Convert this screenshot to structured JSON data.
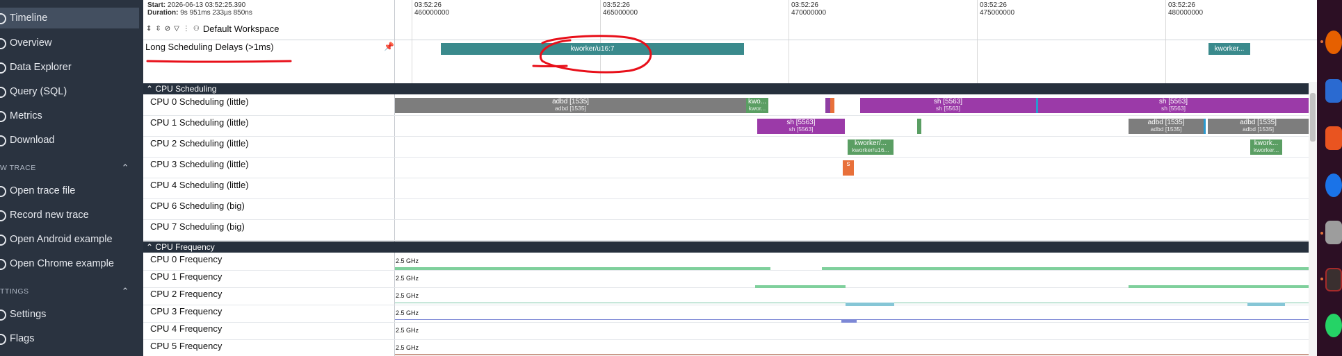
{
  "sidebar": {
    "items_top": [
      {
        "label": "Timeline",
        "icon": "timeline-icon"
      },
      {
        "label": "Overview",
        "icon": "overview-icon"
      },
      {
        "label": "Data Explorer",
        "icon": "data-explorer-icon"
      },
      {
        "label": "Query (SQL)",
        "icon": "query-icon"
      },
      {
        "label": "Metrics",
        "icon": "metrics-icon"
      },
      {
        "label": "Download",
        "icon": "download-icon"
      }
    ],
    "section_trace": "W TRACE",
    "items_trace": [
      {
        "label": "Open trace file",
        "icon": "open-file-icon"
      },
      {
        "label": "Record new trace",
        "icon": "record-icon"
      },
      {
        "label": "Open Android example",
        "icon": "android-icon"
      },
      {
        "label": "Open Chrome example",
        "icon": "chrome-icon"
      }
    ],
    "section_settings": "TTINGS",
    "items_settings": [
      {
        "label": "Settings",
        "icon": "settings-icon"
      },
      {
        "label": "Flags",
        "icon": "flags-icon"
      }
    ],
    "chevron": "⌃"
  },
  "header": {
    "start_label": "Start:",
    "start_value": "2026-06-13 03:52:25.390",
    "duration_label": "Duration:",
    "duration_value": "9s 951ms 233µs 850ns",
    "workspace": "Default Workspace"
  },
  "ticks": [
    {
      "time": "03:52:26",
      "value": "460000000"
    },
    {
      "time": "03:52:26",
      "value": "465000000"
    },
    {
      "time": "03:52:26",
      "value": "470000000"
    },
    {
      "time": "03:52:26",
      "value": "475000000"
    },
    {
      "time": "03:52:26",
      "value": "480000000"
    }
  ],
  "pinned_track": {
    "label": "Long Scheduling Delays (>1ms)",
    "slices": [
      {
        "label": "kworker/u16:7",
        "color": "#3a8a8c"
      },
      {
        "label": "kworker...",
        "color": "#3a8a8c"
      }
    ]
  },
  "cpu_scheduling": {
    "title": "CPU Scheduling",
    "tracks": [
      "CPU 0 Scheduling (little)",
      "CPU 1 Scheduling (little)",
      "CPU 2 Scheduling (little)",
      "CPU 3 Scheduling (little)",
      "CPU 4 Scheduling (little)",
      "CPU 6 Scheduling (big)",
      "CPU 7 Scheduling (big)"
    ],
    "slices": [
      {
        "row": 0,
        "l1": "adbd [1535]",
        "l2": "adbd [1535]",
        "color": "#7d7d7d"
      },
      {
        "row": 0,
        "l1": "kwo...",
        "l2": "kwor...",
        "color": "#5a9e63"
      },
      {
        "row": 0,
        "l1": "",
        "l2": "",
        "color": "#8f3ea3"
      },
      {
        "row": 0,
        "l1": "",
        "l2": "",
        "color": "#e8703a"
      },
      {
        "row": 0,
        "l1": "sh [5563]",
        "l2": "sh [5563]",
        "color": "#9b3aa8"
      },
      {
        "row": 0,
        "l1": "sh [5563]",
        "l2": "sh [5563]",
        "color": "#9b3aa8"
      },
      {
        "row": 1,
        "l1": "sh [5563]",
        "l2": "sh [5563]",
        "color": "#9b3aa8"
      },
      {
        "row": 1,
        "l1": "",
        "l2": "",
        "color": "#5a9e63"
      },
      {
        "row": 1,
        "l1": "adbd [1535]",
        "l2": "adbd [1535]",
        "color": "#7d7d7d"
      },
      {
        "row": 1,
        "l1": "adbd [1535]",
        "l2": "adbd [1535]",
        "color": "#7d7d7d"
      },
      {
        "row": 2,
        "l1": "kworker/...",
        "l2": "kworker/u16...",
        "color": "#5a9e63"
      },
      {
        "row": 2,
        "l1": "kwork...",
        "l2": "kworker...",
        "color": "#5a9e63"
      },
      {
        "row": 3,
        "l1": "s",
        "l2": "",
        "color": "#e8703a"
      }
    ]
  },
  "cpu_frequency": {
    "title": "CPU Frequency",
    "tracks": [
      {
        "label": "CPU 0 Frequency",
        "max": "2.5 GHz",
        "color": "#7fd09c"
      },
      {
        "label": "CPU 1 Frequency",
        "max": "2.5 GHz",
        "color": "#7fd09c"
      },
      {
        "label": "CPU 2 Frequency",
        "max": "2.5 GHz",
        "color": "#74c4a4"
      },
      {
        "label": "CPU 3 Frequency",
        "max": "2.5 GHz",
        "color": "#86c6d6"
      },
      {
        "label": "CPU 4 Frequency",
        "max": "2.5 GHz",
        "color": "#7d88d6"
      },
      {
        "label": "CPU 5 Frequency",
        "max": "2.5 GHz",
        "color": "#c99a8a"
      }
    ]
  },
  "dock": {
    "apps": [
      {
        "icon": "firefox-icon",
        "color": "#e66000"
      },
      {
        "icon": "writer-icon",
        "color": "#2a6ad1"
      },
      {
        "icon": "software-icon",
        "color": "#e95420"
      },
      {
        "icon": "help-icon",
        "color": "#1a73e8"
      },
      {
        "icon": "files-icon",
        "color": "#9d9d9d"
      },
      {
        "icon": "terminal-icon",
        "color": "#3a2f2f"
      },
      {
        "icon": "whatsapp-icon",
        "color": "#25d366"
      }
    ]
  }
}
